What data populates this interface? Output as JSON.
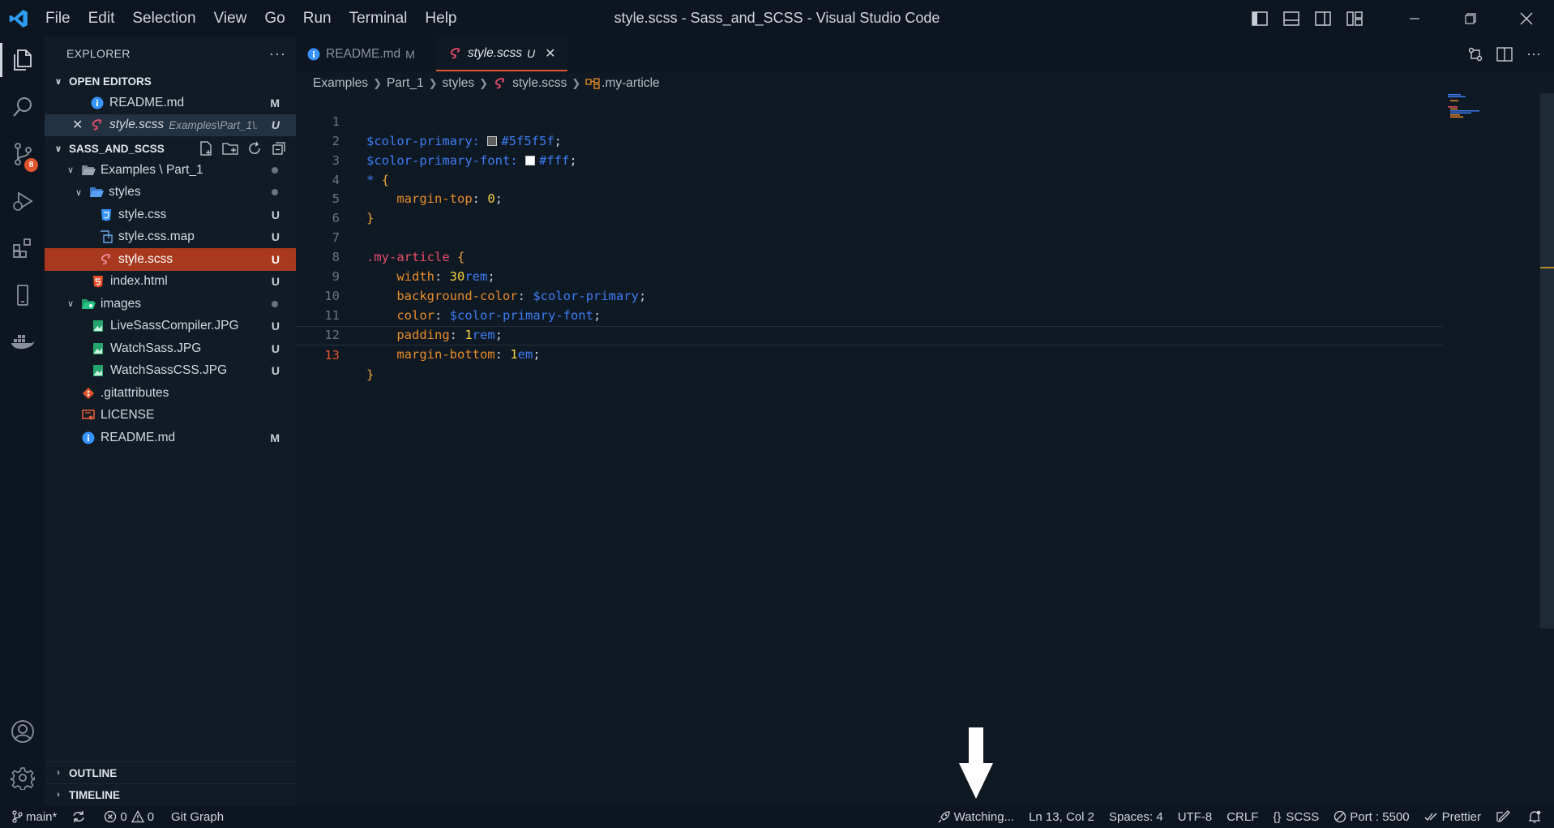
{
  "window": {
    "title": "style.scss - Sass_and_SCSS - Visual Studio Code",
    "menu": [
      "File",
      "Edit",
      "Selection",
      "View",
      "Go",
      "Run",
      "Terminal",
      "Help"
    ]
  },
  "activity_bar": {
    "source_control_badge": "8"
  },
  "sidebar": {
    "title": "EXPLORER",
    "more": "···",
    "open_editors": {
      "header": "OPEN EDITORS",
      "items": [
        {
          "name": "README.md",
          "path": "",
          "status": "M",
          "icon": "info-icon"
        },
        {
          "name": "style.scss",
          "path": "Examples\\Part_1\\...",
          "status": "U",
          "icon": "sass-icon"
        }
      ]
    },
    "project": {
      "header": "SASS_AND_SCSS",
      "tree": [
        {
          "label": "Examples \\ Part_1",
          "status": "dot"
        },
        {
          "label": "styles",
          "status": "dot"
        },
        {
          "label": "style.css",
          "status": "U"
        },
        {
          "label": "style.css.map",
          "status": "U"
        },
        {
          "label": "style.scss",
          "status": "U"
        },
        {
          "label": "index.html",
          "status": "U"
        },
        {
          "label": "images",
          "status": "dot"
        },
        {
          "label": "LiveSassCompiler.JPG",
          "status": "U"
        },
        {
          "label": "WatchSass.JPG",
          "status": "U"
        },
        {
          "label": "WatchSassCSS.JPG",
          "status": "U"
        },
        {
          "label": ".gitattributes",
          "status": ""
        },
        {
          "label": "LICENSE",
          "status": ""
        },
        {
          "label": "README.md",
          "status": "M"
        }
      ]
    },
    "outline": "OUTLINE",
    "timeline": "TIMELINE"
  },
  "tabs": [
    {
      "label": "README.md",
      "status": "M",
      "active": false
    },
    {
      "label": "style.scss",
      "status": "U",
      "active": true
    }
  ],
  "breadcrumb": [
    "Examples",
    "Part_1",
    "styles",
    "style.scss",
    ".my-article"
  ],
  "editor": {
    "line_numbers": [
      "1",
      "2",
      "3",
      "4",
      "5",
      "6",
      "7",
      "8",
      "9",
      "10",
      "11",
      "12",
      "13"
    ],
    "current_line": "13",
    "code": {
      "l1_var": "$color-primary",
      "l1_colon": ": ",
      "l1_val": "#5f5f5f",
      "l1_swatch": "#5f5f5f",
      "l2_var": "$color-primary-font",
      "l2_colon": ": ",
      "l2_val": "#fff",
      "l2_swatch": "#ffffff",
      "l3_sel": "*",
      "l4_prop": "margin-top",
      "l4_num": "0",
      "l7_sel": ".my-article",
      "l8_prop": "width",
      "l8_num": "30",
      "l8_unit": "rem",
      "l9_prop": "background-color",
      "l9_var": "$color-primary",
      "l10_prop": "color",
      "l10_var": "$color-primary-font",
      "l11_prop": "padding",
      "l11_num": "1",
      "l11_unit": "rem",
      "l12_prop": "margin-bottom",
      "l12_num": "1",
      "l12_unit": "em"
    }
  },
  "statusbar": {
    "branch": "main*",
    "errors": "0",
    "warnings": "0",
    "git_graph": "Git Graph",
    "watching": "Watching...",
    "cursor": "Ln 13, Col 2",
    "spaces": "Spaces: 4",
    "encoding": "UTF-8",
    "eol": "CRLF",
    "language": "SCSS",
    "port": "Port : 5500",
    "prettier": "Prettier"
  },
  "colors": {
    "accent": "#e0552c",
    "background": "#0f1923",
    "selected_row": "#a8391e"
  }
}
